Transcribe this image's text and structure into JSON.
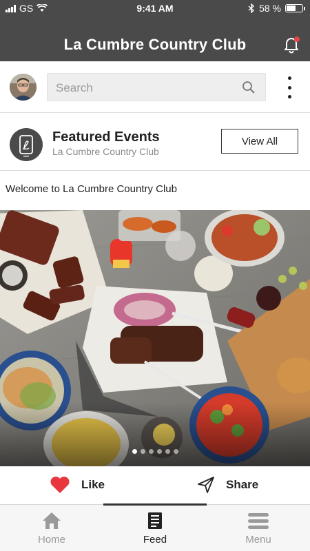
{
  "status": {
    "carrier": "GS",
    "time": "9:41 AM",
    "battery": "58 %",
    "battery_level": 0.58
  },
  "header": {
    "title": "La Cumbre Country Club",
    "has_notification": true
  },
  "search": {
    "placeholder": "Search"
  },
  "featured": {
    "title": "Featured Events",
    "subtitle": "La Cumbre Country Club",
    "view_all_label": "View All"
  },
  "post": {
    "text": "Welcome to La Cumbre Country Club",
    "carousel_count": 6,
    "carousel_index": 0
  },
  "actions": {
    "like_label": "Like",
    "share_label": "Share"
  },
  "tabs": [
    {
      "label": "Home",
      "icon": "home-icon",
      "active": false
    },
    {
      "label": "Feed",
      "icon": "feed-icon",
      "active": true
    },
    {
      "label": "Menu",
      "icon": "menu-icon",
      "active": false
    }
  ],
  "colors": {
    "header_bg": "#4a4a4a",
    "like_red": "#e8363d",
    "notification_dot": "#e64545"
  }
}
